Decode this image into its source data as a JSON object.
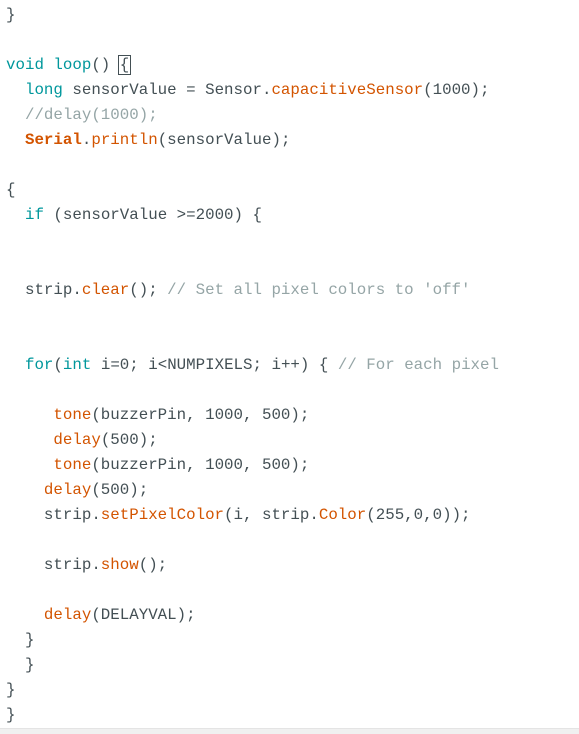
{
  "editor": {
    "lines": [
      [
        {
          "t": "}",
          "c": "plain"
        }
      ],
      [],
      [
        {
          "t": "void",
          "c": "kw-type"
        },
        {
          "t": " ",
          "c": "plain"
        },
        {
          "t": "loop",
          "c": "kw-type"
        },
        {
          "t": "() ",
          "c": "plain"
        },
        {
          "t": "{",
          "c": "plain",
          "box": true
        }
      ],
      [
        {
          "t": "  ",
          "c": "plain"
        },
        {
          "t": "long",
          "c": "kw-type"
        },
        {
          "t": " sensorValue = Sensor.",
          "c": "plain"
        },
        {
          "t": "capacitiveSensor",
          "c": "kw-fn"
        },
        {
          "t": "(1000);",
          "c": "plain"
        }
      ],
      [
        {
          "t": "  ",
          "c": "plain"
        },
        {
          "t": "//delay(1000);",
          "c": "comment"
        }
      ],
      [
        {
          "t": "  ",
          "c": "plain"
        },
        {
          "t": "Serial",
          "c": "kw-serial"
        },
        {
          "t": ".",
          "c": "plain"
        },
        {
          "t": "println",
          "c": "kw-fn"
        },
        {
          "t": "(sensorValue);",
          "c": "plain"
        }
      ],
      [],
      [
        {
          "t": "{",
          "c": "plain"
        }
      ],
      [
        {
          "t": "  ",
          "c": "plain"
        },
        {
          "t": "if",
          "c": "kw-type"
        },
        {
          "t": " (sensorValue >=2000) {",
          "c": "plain"
        }
      ],
      [],
      [],
      [
        {
          "t": "  strip.",
          "c": "plain"
        },
        {
          "t": "clear",
          "c": "kw-fn"
        },
        {
          "t": "(); ",
          "c": "plain"
        },
        {
          "t": "// Set all pixel colors to 'off'",
          "c": "comment"
        }
      ],
      [],
      [],
      [
        {
          "t": "  ",
          "c": "plain"
        },
        {
          "t": "for",
          "c": "kw-type"
        },
        {
          "t": "(",
          "c": "plain"
        },
        {
          "t": "int",
          "c": "kw-type"
        },
        {
          "t": " i=0; i<NUMPIXELS; i++) { ",
          "c": "plain"
        },
        {
          "t": "// For each pixel",
          "c": "comment"
        }
      ],
      [],
      [
        {
          "t": "     ",
          "c": "plain"
        },
        {
          "t": "tone",
          "c": "kw-fn"
        },
        {
          "t": "(buzzerPin, 1000, 500);",
          "c": "plain"
        }
      ],
      [
        {
          "t": "     ",
          "c": "plain"
        },
        {
          "t": "delay",
          "c": "kw-fn"
        },
        {
          "t": "(500);",
          "c": "plain"
        }
      ],
      [
        {
          "t": "     ",
          "c": "plain"
        },
        {
          "t": "tone",
          "c": "kw-fn"
        },
        {
          "t": "(buzzerPin, 1000, 500);",
          "c": "plain"
        }
      ],
      [
        {
          "t": "    ",
          "c": "plain"
        },
        {
          "t": "delay",
          "c": "kw-fn"
        },
        {
          "t": "(500);",
          "c": "plain"
        }
      ],
      [
        {
          "t": "    strip.",
          "c": "plain"
        },
        {
          "t": "setPixelColor",
          "c": "kw-fn"
        },
        {
          "t": "(i, strip.",
          "c": "plain"
        },
        {
          "t": "Color",
          "c": "kw-fn"
        },
        {
          "t": "(255,0,0));",
          "c": "plain"
        }
      ],
      [],
      [
        {
          "t": "    strip.",
          "c": "plain"
        },
        {
          "t": "show",
          "c": "kw-fn"
        },
        {
          "t": "();",
          "c": "plain"
        }
      ],
      [],
      [
        {
          "t": "    ",
          "c": "plain"
        },
        {
          "t": "delay",
          "c": "kw-fn"
        },
        {
          "t": "(DELAYVAL);",
          "c": "plain"
        }
      ],
      [
        {
          "t": "  }",
          "c": "plain"
        }
      ],
      [
        {
          "t": "  }",
          "c": "plain"
        }
      ],
      [
        {
          "t": "}",
          "c": "plain"
        }
      ],
      [
        {
          "t": "}",
          "c": "plain"
        }
      ]
    ]
  }
}
